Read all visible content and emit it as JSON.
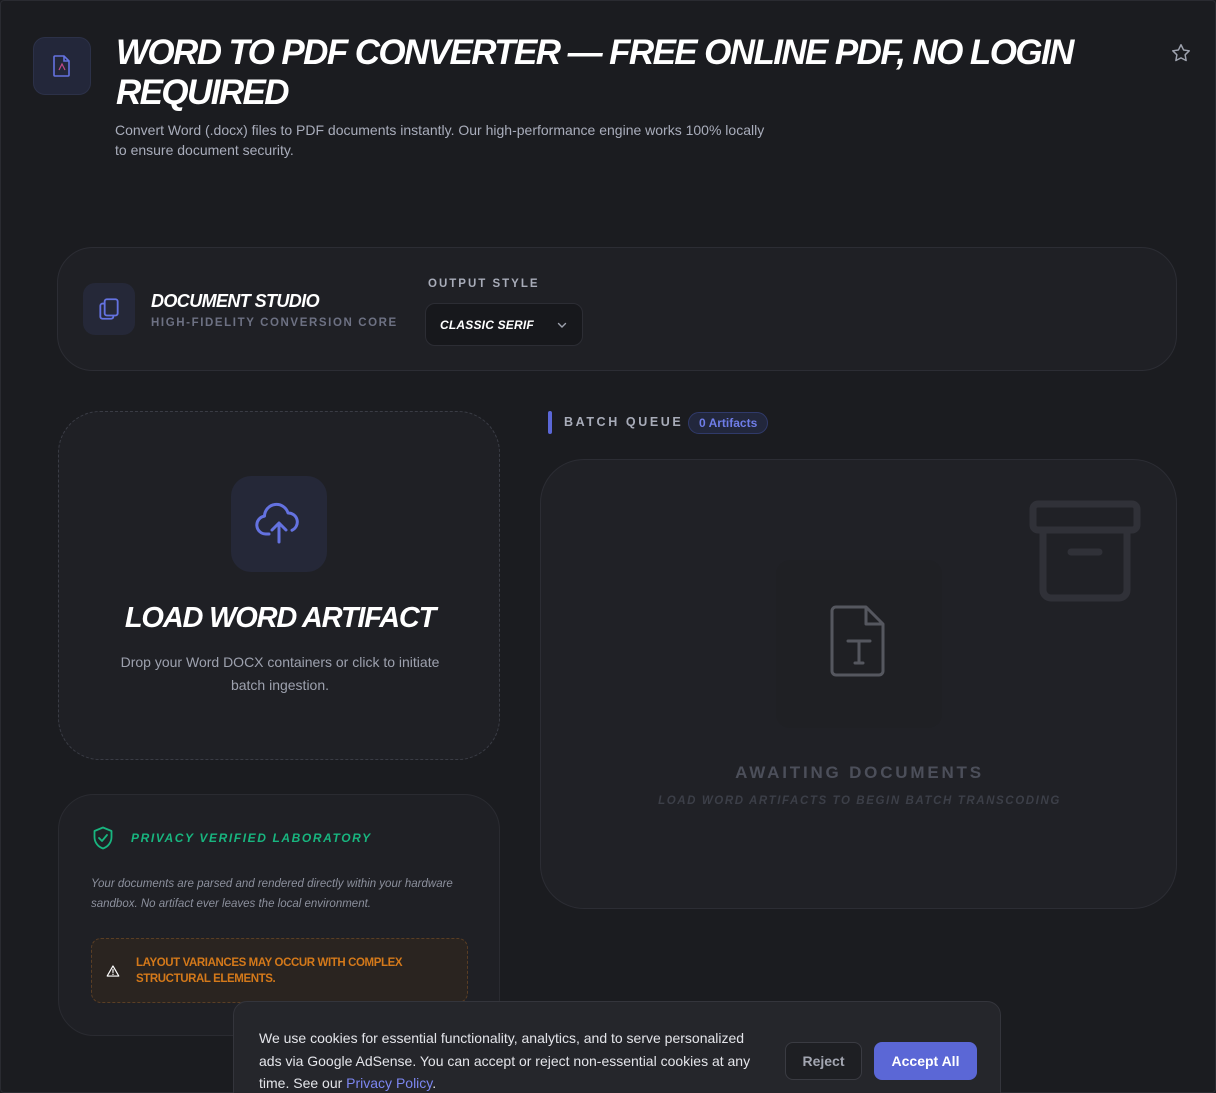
{
  "header": {
    "title": "WORD TO PDF CONVERTER — FREE ONLINE PDF, NO LOGIN REQUIRED",
    "subtitle": "Convert Word (.docx) files to PDF documents instantly. Our high-performance engine works 100% locally to ensure document security.",
    "app_icon": "document-icon",
    "star_icon": "star-icon"
  },
  "studio": {
    "title": "DOCUMENT STUDIO",
    "subtitle": "HIGH-FIDELITY CONVERSION CORE",
    "icon": "copy-documents-icon",
    "output_label": "OUTPUT STYLE",
    "output_value": "CLASSIC SERIF"
  },
  "upload": {
    "icon": "cloud-upload-icon",
    "title": "LOAD WORD ARTIFACT",
    "description": "Drop your Word DOCX containers or click to initiate batch ingestion."
  },
  "privacy": {
    "icon": "shield-check-icon",
    "title": "PRIVACY VERIFIED LABORATORY",
    "text": "Your documents are parsed and rendered directly within your hardware sandbox. No artifact ever leaves the local environment.",
    "warning_icon": "warning-triangle-icon",
    "warning": "LAYOUT VARIANCES MAY OCCUR WITH COMPLEX STRUCTURAL ELEMENTS."
  },
  "queue": {
    "label": "BATCH QUEUE",
    "badge": "0 Artifacts",
    "empty_title": "AWAITING DOCUMENTS",
    "empty_subtitle": "LOAD WORD ARTIFACTS TO BEGIN BATCH TRANSCODING",
    "archive_icon": "archive-box-icon",
    "doc_icon": "text-document-icon"
  },
  "cookie": {
    "text_before": "We use cookies for essential functionality, analytics, and to serve personalized ads via Google AdSense. You can accept or reject non-essential cookies at any time. See our ",
    "link": "Privacy Policy",
    "text_after": ".",
    "reject": "Reject",
    "accept": "Accept All"
  },
  "colors": {
    "accent": "#5b67d6",
    "success": "#18b57f",
    "warning": "#d4791a",
    "background": "#1b1c20"
  }
}
